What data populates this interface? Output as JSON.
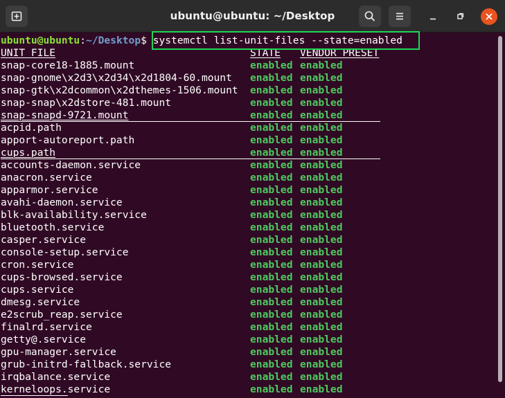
{
  "window": {
    "title": "ubuntu@ubuntu: ~/Desktop",
    "new_tab_icon": "new-tab-icon",
    "search_icon": "search-icon",
    "menu_icon": "hamburger-menu-icon",
    "close_color": "#e95420"
  },
  "prompt": {
    "user": "ubuntu@ubuntu",
    "colon": ":",
    "path": "~/Desktop",
    "dollar": "$",
    "command": "systemctl list-unit-files --state=enabled"
  },
  "colors": {
    "background": "#300a24",
    "prompt_user": "#8ae234",
    "prompt_path": "#729fcf",
    "enabled_text": "#4ec95f",
    "highlight_box": "#1fd655"
  },
  "table": {
    "headers": {
      "unit_file": "UNIT FILE",
      "state": "STATE",
      "vendor_preset": "VENDOR PRESET"
    },
    "rows": [
      {
        "unit": "snap-core18-1885.mount",
        "state": "enabled",
        "vendor": "enabled"
      },
      {
        "unit": "snap-gnome\\x2d3\\x2d34\\x2d1804-60.mount",
        "state": "enabled",
        "vendor": "enabled"
      },
      {
        "unit": "snap-gtk\\x2dcommon\\x2dthemes-1506.mount",
        "state": "enabled",
        "vendor": "enabled"
      },
      {
        "unit": "snap-snap\\x2dstore-481.mount",
        "state": "enabled",
        "vendor": "enabled"
      },
      {
        "unit": "snap-snapd-9721.mount",
        "state": "enabled",
        "vendor": "enabled"
      },
      {
        "unit": "acpid.path",
        "state": "enabled",
        "vendor": "enabled"
      },
      {
        "unit": "apport-autoreport.path",
        "state": "enabled",
        "vendor": "enabled"
      },
      {
        "unit": "cups.path",
        "state": "enabled",
        "vendor": "enabled"
      },
      {
        "unit": "accounts-daemon.service",
        "state": "enabled",
        "vendor": "enabled"
      },
      {
        "unit": "anacron.service",
        "state": "enabled",
        "vendor": "enabled"
      },
      {
        "unit": "apparmor.service",
        "state": "enabled",
        "vendor": "enabled"
      },
      {
        "unit": "avahi-daemon.service",
        "state": "enabled",
        "vendor": "enabled"
      },
      {
        "unit": "blk-availability.service",
        "state": "enabled",
        "vendor": "enabled"
      },
      {
        "unit": "bluetooth.service",
        "state": "enabled",
        "vendor": "enabled"
      },
      {
        "unit": "casper.service",
        "state": "enabled",
        "vendor": "enabled"
      },
      {
        "unit": "console-setup.service",
        "state": "enabled",
        "vendor": "enabled"
      },
      {
        "unit": "cron.service",
        "state": "enabled",
        "vendor": "enabled"
      },
      {
        "unit": "cups-browsed.service",
        "state": "enabled",
        "vendor": "enabled"
      },
      {
        "unit": "cups.service",
        "state": "enabled",
        "vendor": "enabled"
      },
      {
        "unit": "dmesg.service",
        "state": "enabled",
        "vendor": "enabled"
      },
      {
        "unit": "e2scrub_reap.service",
        "state": "enabled",
        "vendor": "enabled"
      },
      {
        "unit": "finalrd.service",
        "state": "enabled",
        "vendor": "enabled"
      },
      {
        "unit": "getty@.service",
        "state": "enabled",
        "vendor": "enabled"
      },
      {
        "unit": "gpu-manager.service",
        "state": "enabled",
        "vendor": "enabled"
      },
      {
        "unit": "grub-initrd-fallback.service",
        "state": "enabled",
        "vendor": "enabled"
      },
      {
        "unit": "irqbalance.service",
        "state": "enabled",
        "vendor": "enabled"
      },
      {
        "unit": "kerneloops.service",
        "state": "enabled",
        "vendor": "enabled"
      }
    ]
  }
}
